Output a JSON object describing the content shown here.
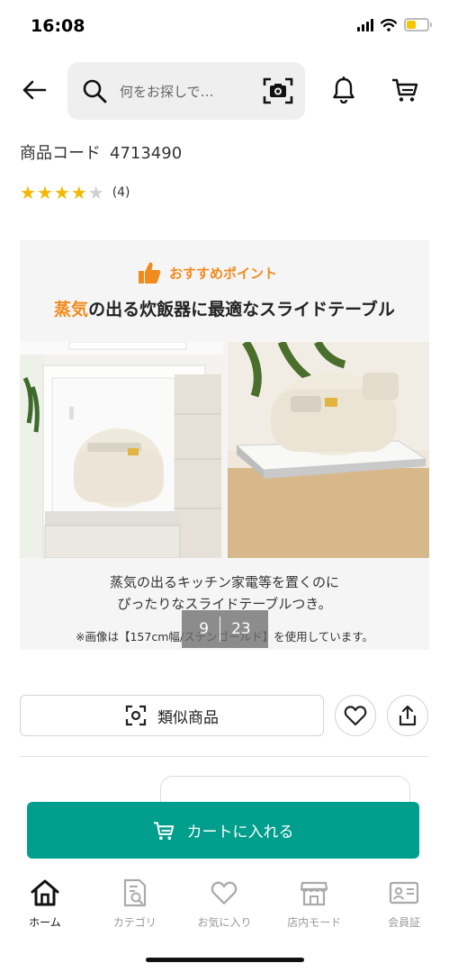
{
  "status_bar": {
    "time": "16:08",
    "battery_level": 0.45,
    "battery_color": "#f2c700"
  },
  "header": {
    "back_icon": "back-arrow-icon",
    "search_placeholder": "何をお探しで…",
    "camera_icon": "camera-search-icon",
    "bell_icon": "bell-icon",
    "cart_icon": "cart-icon"
  },
  "product": {
    "code_label": "商品コード",
    "code_value": "4713490",
    "rating": 4,
    "rating_max": 5,
    "review_count": "(4)"
  },
  "hero": {
    "badge": "おすすめポイント",
    "title_accent": "蒸気",
    "title_rest": "の出る炊飯器に最適なスライドテーブル",
    "caption_line1": "蒸気の出るキッチン家電等を置くのに",
    "caption_line2": "ぴったりなスライドテーブルつき。",
    "note": "※画像は【157cm幅/ステンゴールド】を使用しています。",
    "accent_color": "#f08c1e"
  },
  "image_pager": {
    "current": "9",
    "total": "23"
  },
  "actions": {
    "similar_label": "類似商品",
    "favorite_icon": "heart-icon",
    "share_icon": "share-icon"
  },
  "cart_button": {
    "label": "カートに入れる",
    "color": "#009e8c"
  },
  "bottom_nav": {
    "items": [
      {
        "label": "ホーム",
        "icon": "home-icon",
        "active": true
      },
      {
        "label": "カテゴリ",
        "icon": "category-icon",
        "active": false
      },
      {
        "label": "お気に入り",
        "icon": "heart-icon",
        "active": false
      },
      {
        "label": "店内モード",
        "icon": "store-icon",
        "active": false
      },
      {
        "label": "会員証",
        "icon": "member-card-icon",
        "active": false
      }
    ]
  }
}
